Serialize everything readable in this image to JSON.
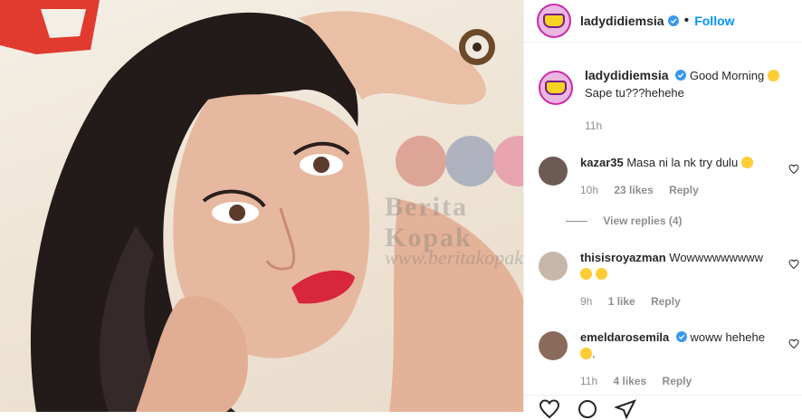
{
  "post": {
    "author": "ladydidiemsia",
    "follow_label": "Follow",
    "caption_text": "Good Morning",
    "caption_line2": "Sape tu???hehehe",
    "caption_time": "11h",
    "watermark_brand": "Berita Kopak",
    "watermark_url": "www.beritakopak"
  },
  "comments": [
    {
      "user": "kazar35",
      "text": "Masa ni la nk try dulu",
      "time": "10h",
      "likes": "23 likes",
      "reply": "Reply",
      "view_replies": "View replies (4)"
    },
    {
      "user": "thisisroyazman",
      "text": "Wowwwwwwwww",
      "time": "9h",
      "likes": "1 like",
      "reply": "Reply"
    },
    {
      "user": "emeldarosemila",
      "text": "woww hehehe",
      "text2": ".",
      "time": "11h",
      "likes": "4 likes",
      "reply": "Reply"
    }
  ],
  "colors": {
    "accent": "#0095f6",
    "verified": "#3897f0",
    "lip": "#d7263d"
  }
}
